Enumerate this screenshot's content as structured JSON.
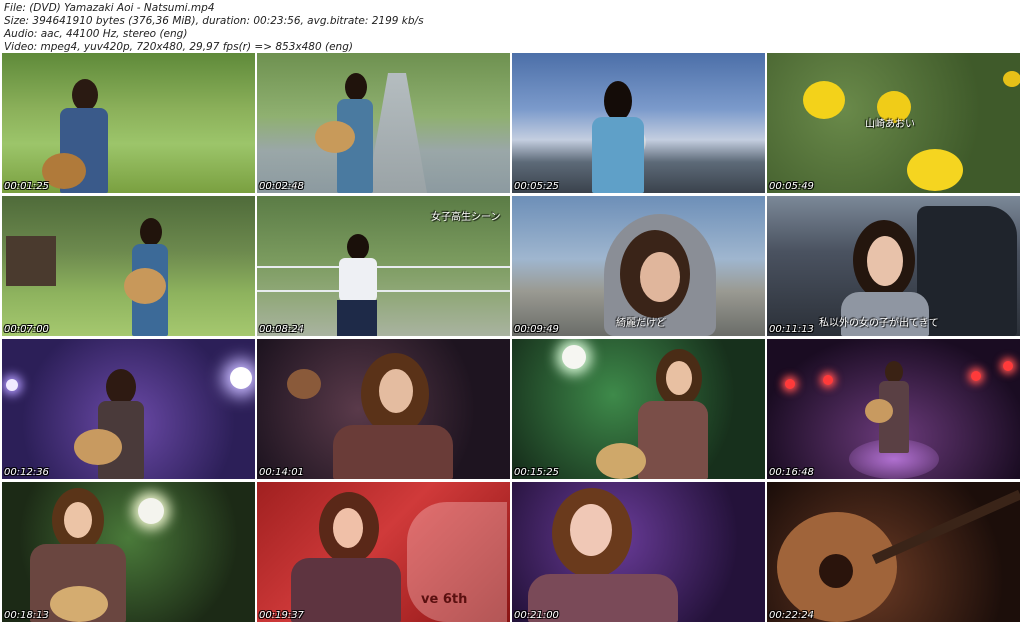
{
  "info": {
    "file": "File: (DVD) Yamazaki Aoi - Natsumi.mp4",
    "size": "Size: 394641910 bytes (376,36 MiB), duration: 00:23:56, avg.bitrate: 2199 kb/s",
    "audio": "Audio: aac, 44100 Hz, stereo (eng)",
    "video": "Video: mpeg4, yuv420p, 720x480, 29,97 fps(r) => 853x480 (eng)"
  },
  "thumbnails": [
    {
      "time": "00:01:25",
      "subtitle": ""
    },
    {
      "time": "00:02:48",
      "subtitle": ""
    },
    {
      "time": "00:05:25",
      "subtitle": ""
    },
    {
      "time": "00:05:49",
      "subtitle": "山崎あおい"
    },
    {
      "time": "00:07:00",
      "subtitle": ""
    },
    {
      "time": "00:08:24",
      "subtitle": "女子高生シーン"
    },
    {
      "time": "00:09:49",
      "subtitle": "綺麗だけど"
    },
    {
      "time": "00:11:13",
      "subtitle": "私以外の女の子が出てきて"
    },
    {
      "time": "00:12:36",
      "subtitle": ""
    },
    {
      "time": "00:14:01",
      "subtitle": ""
    },
    {
      "time": "00:15:25",
      "subtitle": ""
    },
    {
      "time": "00:16:48",
      "subtitle": ""
    },
    {
      "time": "00:18:13",
      "subtitle": ""
    },
    {
      "time": "00:19:37",
      "subtitle": "ve 6th"
    },
    {
      "time": "00:21:00",
      "subtitle": ""
    },
    {
      "time": "00:22:24",
      "subtitle": ""
    }
  ]
}
